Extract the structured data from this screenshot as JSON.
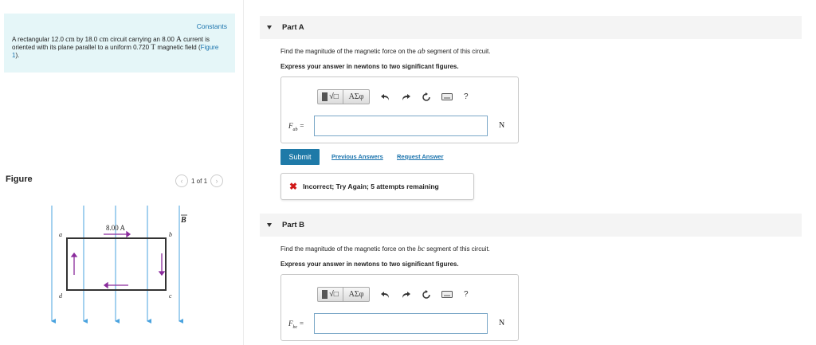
{
  "problem": {
    "constants_label": "Constants",
    "text_1": "A rectangular 12.0 ",
    "unit_cm_1": "cm",
    "text_2": " by 18.0 ",
    "unit_cm_2": "cm",
    "text_3": " circuit carrying an 8.00 ",
    "unit_A": "A",
    "text_4": " current is oriented with its plane parallel to a uniform 0.720 ",
    "unit_T": "T",
    "text_5": " magnetic field (",
    "figure_link": "Figure 1",
    "text_6": ")."
  },
  "figure": {
    "label": "Figure",
    "pager_text": "1 of 1",
    "prev_icon": "chevron-left-icon",
    "next_icon": "chevron-right-icon",
    "current_label": "8.00 A",
    "field_label": "B",
    "corner_a": "a",
    "corner_b": "b",
    "corner_c": "c",
    "corner_d": "d"
  },
  "part_a": {
    "title": "Part A",
    "question_pre": "Find the magnitude of the magnetic force on the ",
    "segment": "ab",
    "question_post": " segment of this circuit.",
    "instruction": "Express your answer in newtons to two significant figures.",
    "var_main": "F",
    "var_sub": "ab",
    "equals": " =",
    "input_value": "",
    "unit": "N",
    "submit_label": "Submit",
    "previous_answers_label": "Previous Answers",
    "request_answer_label": "Request Answer",
    "feedback_text": "Incorrect; Try Again; 5 attempts remaining"
  },
  "part_b": {
    "title": "Part B",
    "question_pre": "Find the magnitude of the magnetic force on the ",
    "segment": "bc",
    "question_post": " segment of this circuit.",
    "instruction": "Express your answer in newtons to two significant figures.",
    "var_main": "F",
    "var_sub": "bc",
    "equals": " =",
    "input_value": "",
    "unit": "N"
  },
  "toolbar": {
    "templates_icon": "radical-templates-icon",
    "greek_label": "ΑΣφ",
    "undo_icon": "undo-icon",
    "redo_icon": "redo-icon",
    "reset_icon": "reset-icon",
    "keyboard_icon": "keyboard-icon",
    "help_label": "?"
  },
  "colors": {
    "accent": "#1f7aa8",
    "link": "#1a73ad",
    "problem_bg": "#e5f6f8",
    "error": "#d01717",
    "field_lines": "#4aa3df",
    "current_arrows": "#8a2b9c"
  }
}
